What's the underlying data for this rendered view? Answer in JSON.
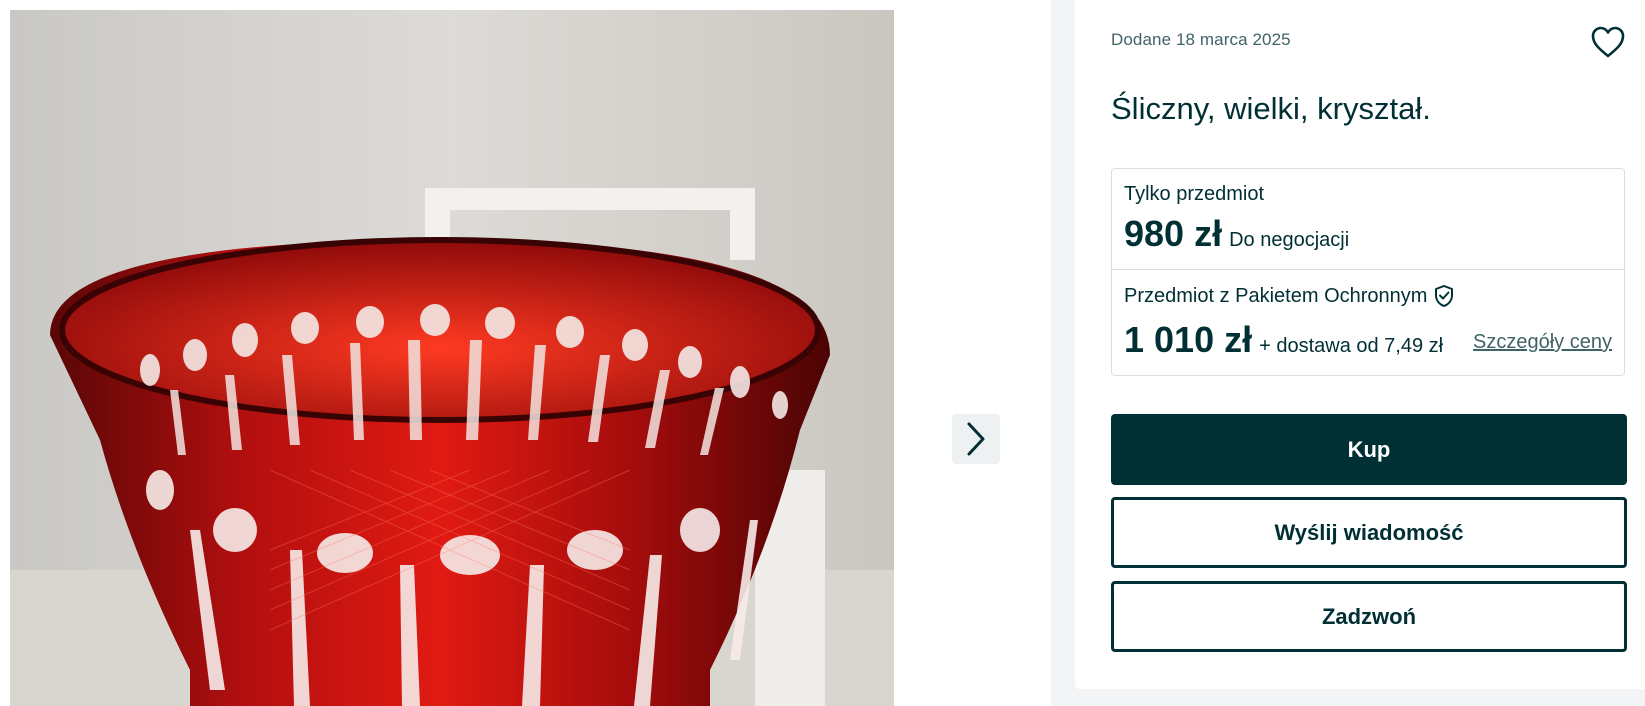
{
  "gallery": {
    "photo_icon": "crystal-bowl-photo",
    "next_icon": "chevron-right-icon"
  },
  "listing": {
    "date": "Dodane 18 marca 2025",
    "favorite_icon": "heart-icon",
    "title": "Śliczny, wielki, kryształ."
  },
  "pricing": {
    "item_only_label": "Tylko przedmiot",
    "item_only_price": "980 zł",
    "negotiable": "Do negocjacji",
    "protection_label": "Przedmiot z Pakietem Ochronnym",
    "protection_icon": "shield-check-icon",
    "protection_price": "1 010 zł",
    "shipping": "+ dostawa od 7,49 zł",
    "details_link": "Szczegóły ceny"
  },
  "actions": {
    "buy": "Kup",
    "message": "Wyślij wiadomość",
    "call": "Zadzwoń"
  },
  "colors": {
    "brand_dark": "#002f34",
    "muted_text": "#406367",
    "sidebar_bg": "#f2f4f5",
    "border": "#d8dfe0"
  }
}
